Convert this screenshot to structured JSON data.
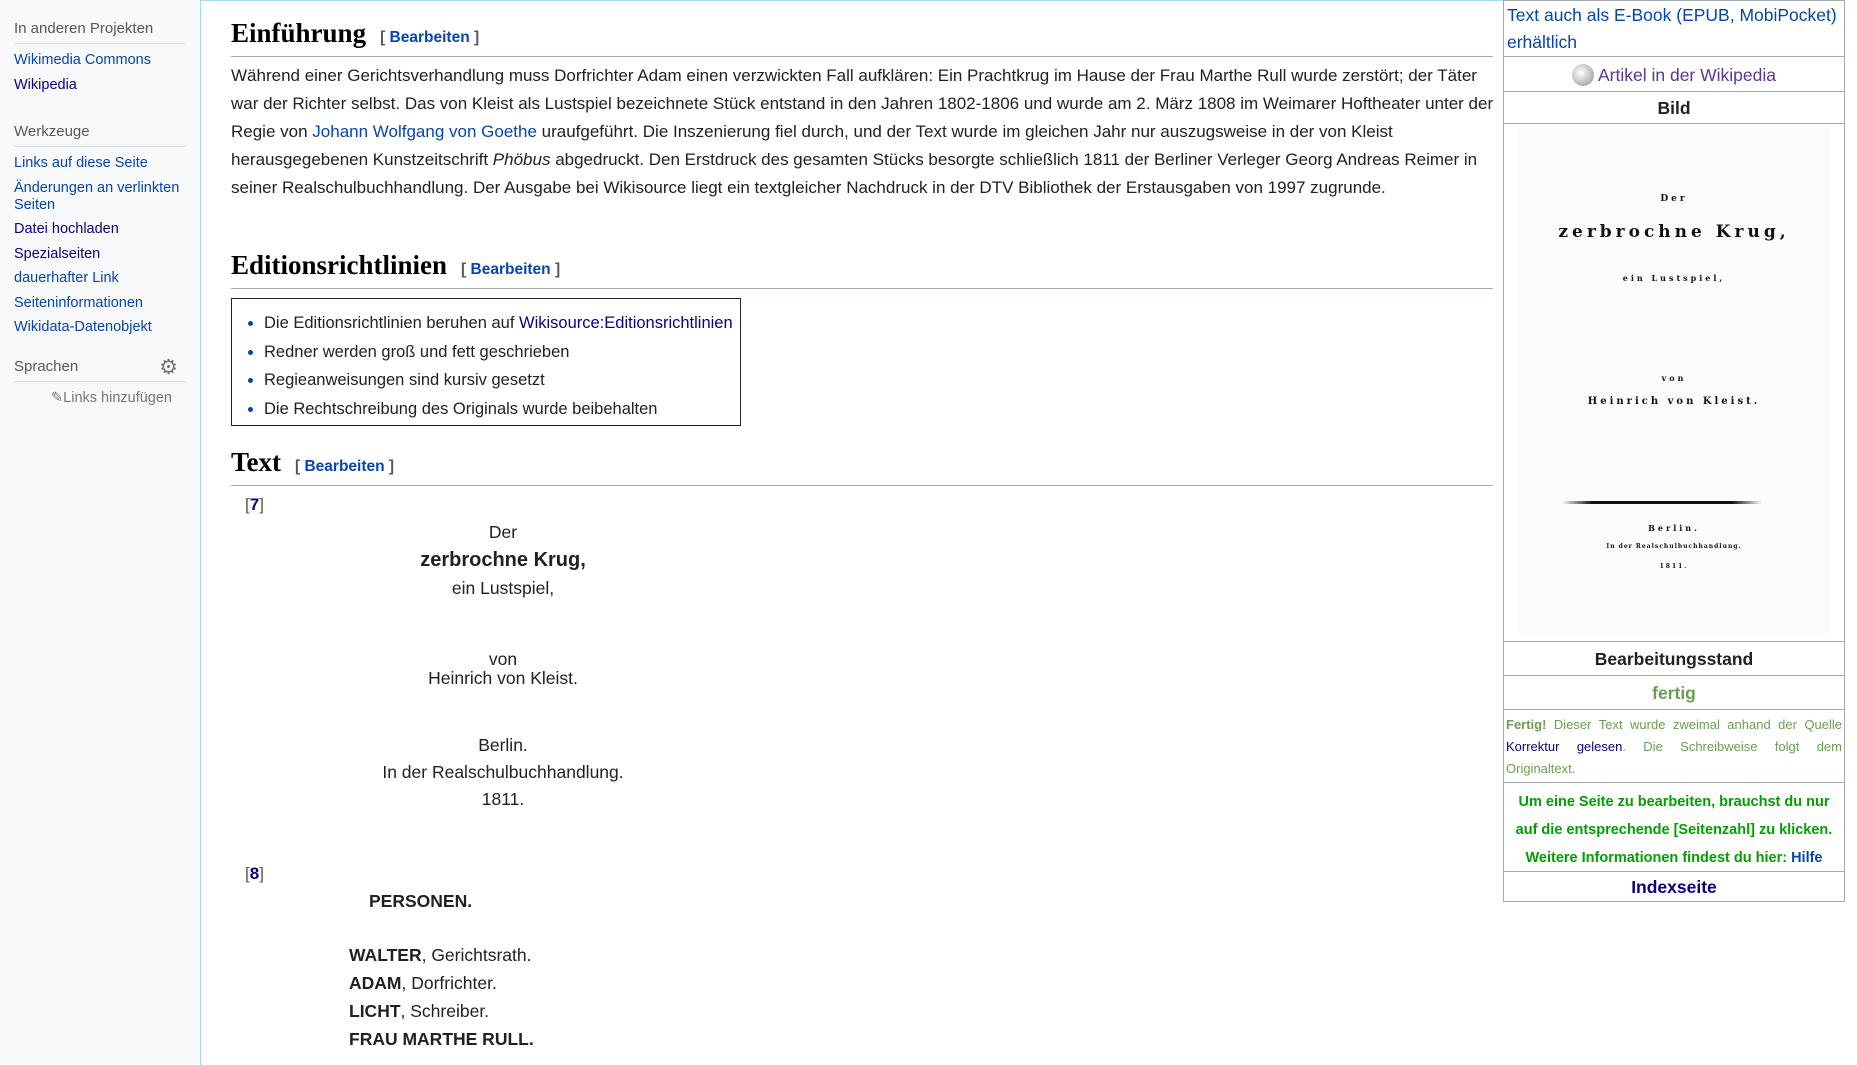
{
  "sidebar": {
    "other_projects": {
      "heading": "In anderen Projekten",
      "items": [
        "Wikimedia Commons",
        "Wikipedia"
      ]
    },
    "tools": {
      "heading": "Werkzeuge",
      "items": [
        "Links auf diese Seite",
        "Änderungen an verlinkten Seiten",
        "Datei hochladen",
        "Spezialseiten",
        "dauerhafter Link",
        "Seiteninformationen",
        "Wikidata-Datenobjekt"
      ]
    },
    "languages": {
      "heading": "Sprachen",
      "gear_icon": "gear-icon",
      "add_links": "Links hinzufügen"
    }
  },
  "main": {
    "intro": {
      "heading": "Einführung",
      "edit": "Bearbeiten",
      "text_before_link": "Während einer Gerichtsverhandlung muss Dorfrichter Adam einen verzwickten Fall aufklären: Ein Prachtkrug im Hause der Frau Marthe Rull wurde zerstört; der Täter war der Richter selbst. Das von Kleist als Lustspiel bezeichnete Stück entstand in den Jahren 1802-1806 und wurde am 2. März 1808 im Weimarer Hoftheater unter der Regie von ",
      "link": "Johann Wolfgang von Goethe",
      "text_middle": " uraufgeführt. Die Inszenierung fiel durch, und der Text wurde im gleichen Jahr nur auszugsweise in der von Kleist herausgegebenen Kunstzeitschrift ",
      "italic": "Phöbus",
      "text_after": " abgedruckt. Den Erstdruck des gesamten Stücks besorgte schließlich 1811 der Berliner Verleger Georg Andreas Reimer in seiner Realschulbuchhandlung. Der Ausgabe bei Wikisource liegt ein textgleicher Nachdruck in der DTV Bibliothek der Erstausgaben von 1997 zugrunde."
    },
    "guidelines": {
      "heading": "Editionsrichtlinien",
      "edit": "Bearbeiten",
      "items": [
        {
          "text": "Die Editionsrichtlinien beruhen auf ",
          "link": "Wikisource:Editionsrichtlinien"
        },
        {
          "text": "Redner werden groß und fett geschrieben",
          "link": ""
        },
        {
          "text": "Regieanweisungen sind kursiv gesetzt",
          "link": ""
        },
        {
          "text": "Die Rechtschreibung des Originals wurde beibehalten",
          "link": ""
        }
      ]
    },
    "text": {
      "heading": "Text",
      "edit": "Bearbeiten",
      "page7": "7",
      "page8": "8",
      "title_lines": {
        "der": "Der",
        "title": "zerbrochne Krug,",
        "subtitle": "ein Lustspiel,",
        "von": "von",
        "author": "Heinrich von Kleist.",
        "city": "Berlin.",
        "publisher": "In der Realschulbuchhandlung.",
        "year": "1811."
      },
      "persons_heading": "PERSONEN.",
      "persons": [
        {
          "name": "WALTER",
          "role": ", Gerichtsrath."
        },
        {
          "name": "ADAM",
          "role": ", Dorfrichter."
        },
        {
          "name": "LICHT",
          "role": ", Schreiber."
        },
        {
          "name": "FRAU MARTHE RULL.",
          "role": ""
        }
      ]
    }
  },
  "infobox": {
    "ebook": "Text auch als E-Book (EPUB, MobiPocket) erhältlich",
    "wikipedia": "Artikel in der Wikipedia",
    "image_heading": "Bild",
    "title_page": {
      "der": "Der",
      "title": "zerbrochne Krug,",
      "subtitle": "ein Lustspiel,",
      "von": "von",
      "author": "Heinrich von Kleist.",
      "city": "Berlin.",
      "publisher": "In der Realschulbuchhandlung.",
      "year": "1811."
    },
    "status_heading": "Bearbeitungsstand",
    "status": "fertig",
    "status_text_lead": "Fertig!",
    "status_text_1": " Dieser Text wurde zweimal anhand der Quelle ",
    "status_link_1": "Korrektur",
    "status_link_2": "gelesen",
    "status_text_2": ". Die Schreibweise folgt dem Originaltext.",
    "edit_hint_1": "Um eine Seite zu bearbeiten, brauchst du nur auf die entsprechende [Seitenzahl] zu klicken.",
    "edit_hint_2": "Weitere Informationen findest du hier: ",
    "help_link": "Hilfe",
    "index_link": "Indexseite",
    "colors": {
      "status_green": "#6b9e52",
      "hint_green": "#00a000",
      "index_blue": "#0b0080"
    }
  }
}
